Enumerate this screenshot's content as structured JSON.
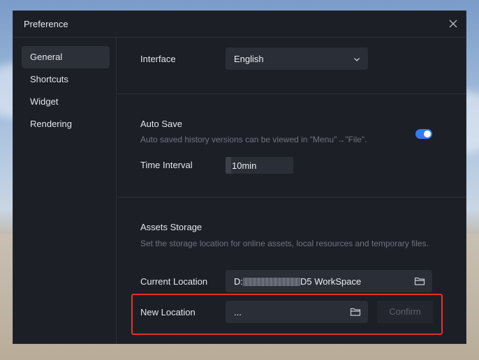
{
  "window": {
    "title": "Preference"
  },
  "sidebar": {
    "items": [
      {
        "label": "General",
        "active": true
      },
      {
        "label": "Shortcuts",
        "active": false
      },
      {
        "label": "Widget",
        "active": false
      },
      {
        "label": "Rendering",
        "active": false
      }
    ]
  },
  "interface": {
    "label": "Interface",
    "selected": "English"
  },
  "auto_save": {
    "label": "Auto Save",
    "description": "Auto saved history versions can be viewed in \"Menu\"→\"File\".",
    "enabled": true,
    "time_interval_label": "Time Interval",
    "time_interval_value": "10min"
  },
  "assets_storage": {
    "label": "Assets Storage",
    "description": "Set the storage location for online assets, local resources and temporary files.",
    "current_location_label": "Current Location",
    "current_location_prefix": "D:",
    "current_location_suffix": "D5 WorkSpace",
    "new_location_label": "New Location",
    "new_location_value": "...",
    "confirm_label": "Confirm"
  },
  "colors": {
    "accent": "#2f7cf6",
    "dialog_bg": "#1c1f26",
    "highlight": "#e5302a"
  }
}
